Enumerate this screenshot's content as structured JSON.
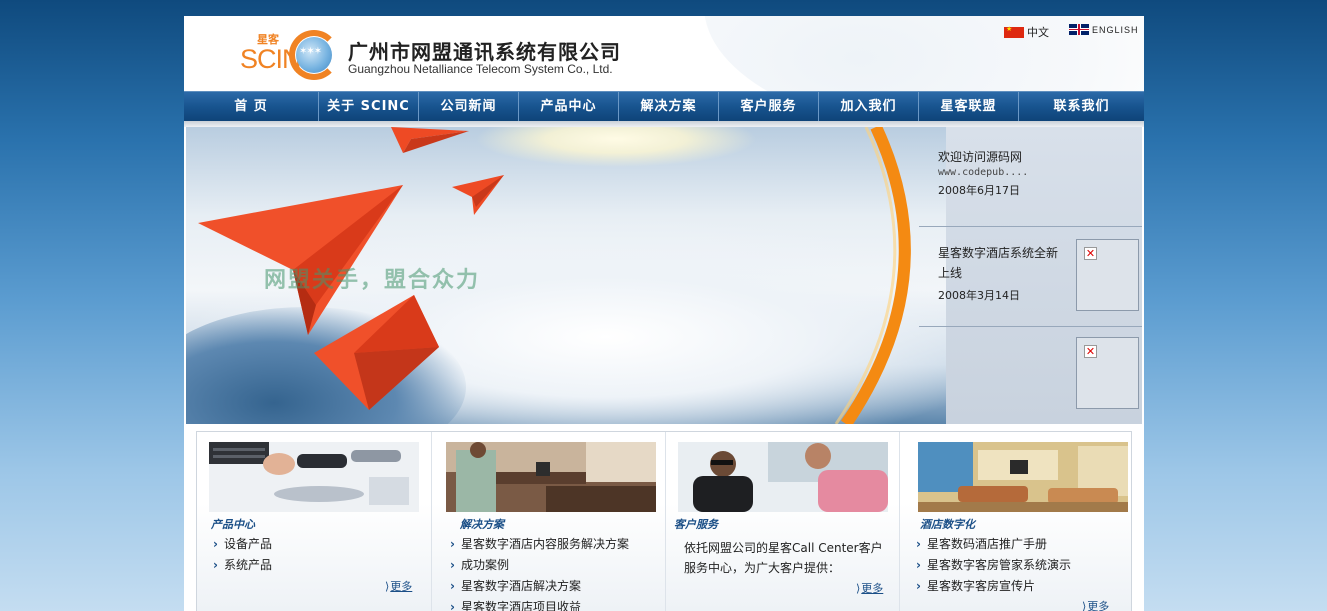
{
  "header": {
    "logo_text": "SCINC",
    "logo_cn": "星客",
    "company_cn": "广州市网盟通讯系统有限公司",
    "company_en": "Guangzhou Netalliance Telecom System Co., Ltd.",
    "lang_cn": "中文",
    "lang_en": "ENGLISH"
  },
  "nav": {
    "items": [
      {
        "label": "首 页"
      },
      {
        "label": "关于 SCINC"
      },
      {
        "label": "公司新闻"
      },
      {
        "label": "产品中心"
      },
      {
        "label": "解决方案"
      },
      {
        "label": "客户服务"
      },
      {
        "label": "加入我们"
      },
      {
        "label": "星客联盟"
      },
      {
        "label": "联系我们"
      }
    ]
  },
  "banner": {
    "slogan": "网盟关手，盟合众力"
  },
  "news": [
    {
      "title": "欢迎访问源码网",
      "sub": "www.codepub....",
      "date": "2008年6月17日"
    },
    {
      "title": "星客数字酒店系统全新上线",
      "date": "2008年3月14日"
    }
  ],
  "sections": [
    {
      "title": "产品中心",
      "items": [
        "设备产品",
        "系统产品"
      ],
      "more": "更多"
    },
    {
      "title": "解决方案",
      "items": [
        "星客数字酒店内容服务解决方案",
        "成功案例",
        "星客数字酒店解决方案",
        "星客数字酒店项目收益"
      ]
    },
    {
      "title": "客户服务",
      "text": "依托网盟公司的星客Call Center客户服务中心，为广大客户提供：",
      "more": "更多"
    },
    {
      "title": "酒店数字化",
      "items": [
        "星客数码酒店推广手册",
        "星客数字客房管家系统演示",
        "星客数字客房宣传片"
      ],
      "more": "更多"
    }
  ]
}
